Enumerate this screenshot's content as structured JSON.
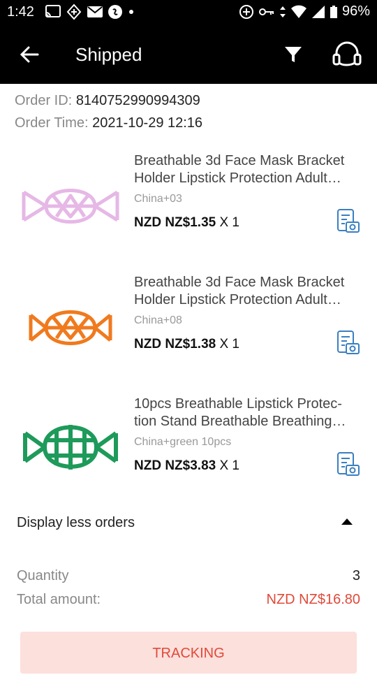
{
  "status_bar": {
    "time": "1:42",
    "battery": "96%"
  },
  "header": {
    "title": "Shipped"
  },
  "order": {
    "id_label": "Order ID:",
    "id_value": "8140752990994309",
    "time_label": "Order Time:",
    "time_value": "2021-10-29 12:16"
  },
  "items": [
    {
      "title": "Breathable 3d Face Mask Bracket Holder Lipstick Protection Adult Reusable",
      "sku": "China+03",
      "price": "NZD NZ$1.35",
      "qty": " X 1",
      "color": "#e6b8e6"
    },
    {
      "title": "Breathable 3d Face Mask Bracket Holder Lipstick Protection Adult Reusable",
      "sku": "China+08",
      "price": "NZD NZ$1.38",
      "qty": " X 1",
      "color": "#f07a1e"
    },
    {
      "title": "10pcs Breathable Lipstick Protec­tion Stand Breathable Breathing Mask Bracket",
      "sku": "China+green 10pcs",
      "price": "NZD NZ$3.83",
      "qty": " X 1",
      "color": "#1e9a5a"
    }
  ],
  "toggle": {
    "label": "Display less orders"
  },
  "summary": {
    "quantity_label": "Quantity",
    "quantity_value": "3",
    "total_label": "Total amount:",
    "total_value": "NZD NZ$16.80"
  },
  "action": {
    "label": "TRACKING"
  },
  "colors": {
    "accent": "#e04a3a",
    "accent_bg": "#fce0dc",
    "icon_blue": "#3a7fc1"
  }
}
